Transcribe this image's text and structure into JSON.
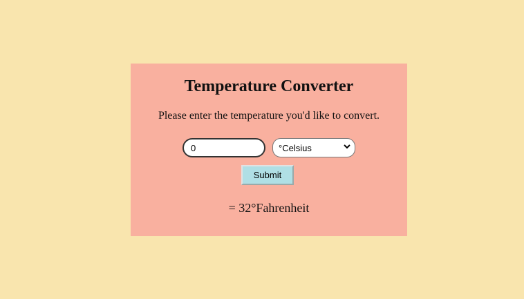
{
  "page": {
    "background_color": "#f9e5ae",
    "card_color": "#f9b09f"
  },
  "converter": {
    "title": "Temperature Converter",
    "prompt": "Please enter the temperature you'd like to convert.",
    "input_value": "0",
    "unit_selected": "°Celsius",
    "submit_label": "Submit",
    "submit_color": "#b0dfe5",
    "result": "= 32°Fahrenheit"
  },
  "icons": {
    "select_arrow": "chevron-down-icon"
  }
}
